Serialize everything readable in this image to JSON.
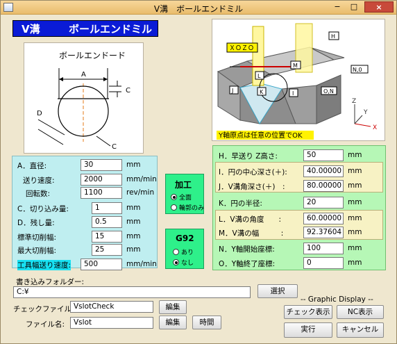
{
  "window": {
    "title": "V溝　ボールエンドミル",
    "minimize": "−",
    "maximize": "□",
    "close": "×"
  },
  "header": {
    "left": "V溝",
    "right": "ボールエンドミル"
  },
  "tool_diagram": {
    "title": "ボールエンドード",
    "labels": {
      "a": "A",
      "c1": "C",
      "c2": "C",
      "d": "D"
    }
  },
  "groove_diagram": {
    "labels": {
      "xozo": "ＸＯＺＯ",
      "h": "H",
      "n0": "N,0",
      "m": "M",
      "l": "L",
      "j": "J",
      "k": "K",
      "i": "I",
      "o_n": "O,N"
    },
    "axes": {
      "z": "Z",
      "y": "Y",
      "x": "X"
    },
    "caption": "Y軸原点は任意の位置でOK"
  },
  "tool_params": [
    {
      "label": "A．直径:",
      "value": "30",
      "unit": "mm"
    },
    {
      "label": "送り速度:",
      "value": "2000",
      "unit": "mm/min"
    },
    {
      "label": "回転数:",
      "value": "1100",
      "unit": "rev/min"
    },
    {
      "label": "C．切り込み量:",
      "value": "1",
      "unit": "mm"
    },
    {
      "label": "D．残し量:",
      "value": "0.5",
      "unit": "mm"
    },
    {
      "label": "標準切削幅:",
      "value": "15",
      "unit": "mm"
    },
    {
      "label": "最大切削幅:",
      "value": "25",
      "unit": "mm"
    },
    {
      "label": "工具幅送り速度:",
      "value": "500",
      "unit": "mm/min"
    }
  ],
  "machining": {
    "title": "加工",
    "options": [
      "全面",
      "輪郭のみ"
    ],
    "selected": 0
  },
  "g92": {
    "title": "G92",
    "options": [
      "あり",
      "なし"
    ],
    "selected": 1
  },
  "groove_params": [
    {
      "label": "H．早送り Z高さ:",
      "value": "50",
      "unit": "mm"
    },
    {
      "label": "I．円の中心深さ(＋):",
      "value": "40.00000",
      "unit": "mm"
    },
    {
      "label": "J．V溝角深さ(＋)　:",
      "value": "80.00000",
      "unit": "mm"
    },
    {
      "label": "K．円の半径:",
      "value": "20",
      "unit": "mm"
    },
    {
      "label": "L．V溝の角度　　:",
      "value": "60.00000",
      "unit": "mm"
    },
    {
      "label": "M．V溝の幅　　　:",
      "value": "92.37604",
      "unit": "mm"
    },
    {
      "label": "N．Y軸開始座標:",
      "value": "100",
      "unit": "mm"
    },
    {
      "label": "O．Y軸終了座標:",
      "value": "0",
      "unit": "mm"
    }
  ],
  "folder": {
    "label": "書き込みフォルダー:",
    "value": "C:¥",
    "select_button": "選択"
  },
  "check_file": {
    "label": "チェックファイル:",
    "value": "VslotCheck",
    "edit_button": "編集"
  },
  "file_name": {
    "label": "ファイル名:",
    "value": "Vslot",
    "edit_button": "編集",
    "time_button": "時間"
  },
  "graphic": {
    "label": "-- Graphic Display --",
    "check_button": "チェック表示",
    "nc_button": "NC表示"
  },
  "actions": {
    "run": "実行",
    "cancel": "キャンセル"
  }
}
